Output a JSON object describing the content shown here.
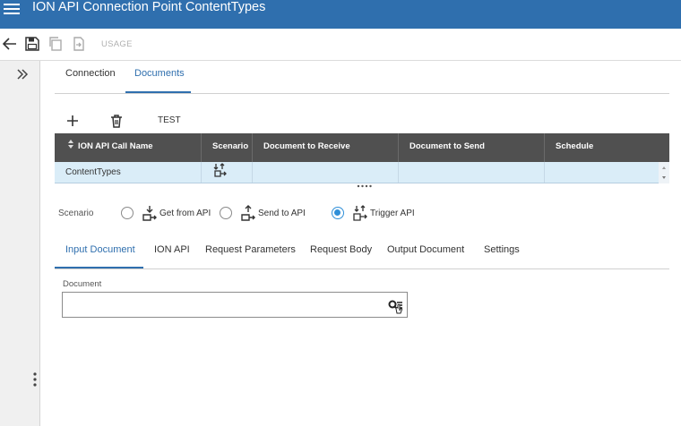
{
  "window": {
    "title": "ION API Connection Point ContentTypes"
  },
  "toolbar": {
    "usage_label": "USAGE"
  },
  "tabs_top": [
    {
      "label": "Connection",
      "active": false
    },
    {
      "label": "Documents",
      "active": true
    }
  ],
  "grid_toolbar": {
    "test_label": "TEST"
  },
  "grid": {
    "columns": [
      "ION API Call Name",
      "Scenario",
      "Document to Receive",
      "Document to Send",
      "Schedule"
    ],
    "rows": [
      {
        "call_name": "ContentTypes",
        "scenario_icon": "trigger-api-icon",
        "document_to_receive": "",
        "document_to_send": "",
        "schedule": ""
      }
    ]
  },
  "scenario": {
    "label": "Scenario",
    "options": [
      {
        "label": "Get from API",
        "icon": "get-from-api-icon",
        "selected": false
      },
      {
        "label": "Send to API",
        "icon": "send-to-api-icon",
        "selected": false
      },
      {
        "label": "Trigger API",
        "icon": "trigger-api-icon",
        "selected": true
      }
    ]
  },
  "tabs_bottom": [
    {
      "label": "Input Document",
      "active": true
    },
    {
      "label": "ION API",
      "active": false
    },
    {
      "label": "Request Parameters",
      "active": false
    },
    {
      "label": "Request Body",
      "active": false
    },
    {
      "label": "Output Document",
      "active": false
    },
    {
      "label": "Settings",
      "active": false
    }
  ],
  "document": {
    "label": "Document",
    "value": ""
  },
  "colors": {
    "header_bar": "#2f6fae",
    "accent": "#2f6fae",
    "grid_header": "#505050",
    "selected_row": "#daedf8",
    "radio_selected": "#2f8fd8"
  }
}
